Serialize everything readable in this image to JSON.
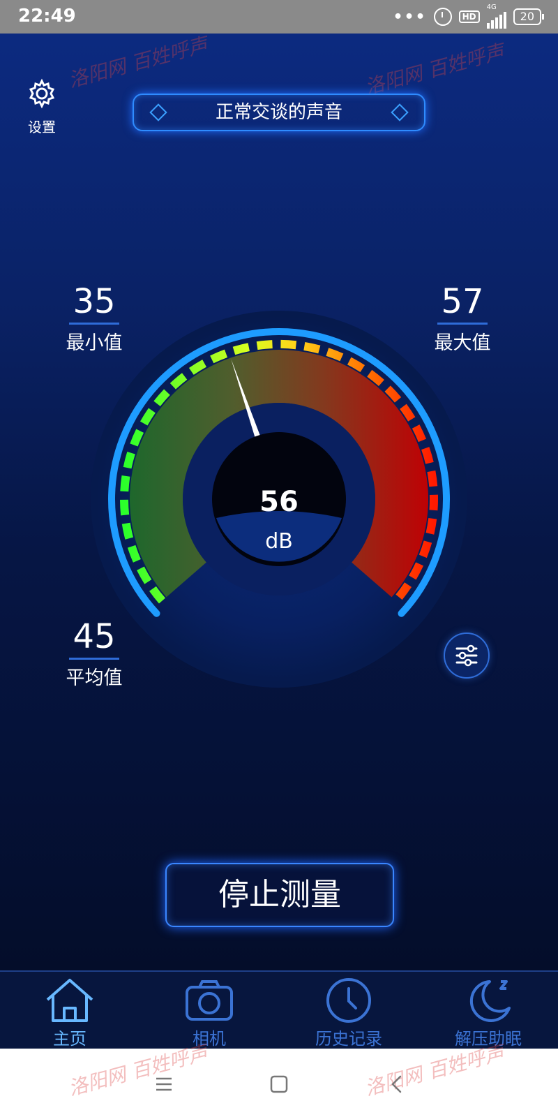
{
  "status_bar": {
    "time": "22:49",
    "dots": "•••",
    "hd": "HD",
    "network": "4G",
    "battery": "20"
  },
  "header": {
    "settings_label": "设置",
    "mode_title": "正常交谈的声音"
  },
  "stats": {
    "min": {
      "value": "35",
      "label": "最小值"
    },
    "max": {
      "value": "57",
      "label": "最大值"
    },
    "avg": {
      "value": "45",
      "label": "平均值"
    }
  },
  "meter": {
    "value": "56",
    "unit": "dB",
    "needle_fraction": 0.43
  },
  "actions": {
    "stop_label": "停止测量"
  },
  "tabs": [
    {
      "label": "主页",
      "icon": "home-icon",
      "active": true
    },
    {
      "label": "相机",
      "icon": "camera-icon"
    },
    {
      "label": "历史记录",
      "icon": "clock-icon"
    },
    {
      "label": "解压助眠",
      "icon": "moon-icon"
    }
  ],
  "watermark": "洛阳网 百姓呼声",
  "colors": {
    "accent": "#2f8cff",
    "active_tab": "#68b8ff",
    "inactive_tab": "#3b73d4"
  }
}
